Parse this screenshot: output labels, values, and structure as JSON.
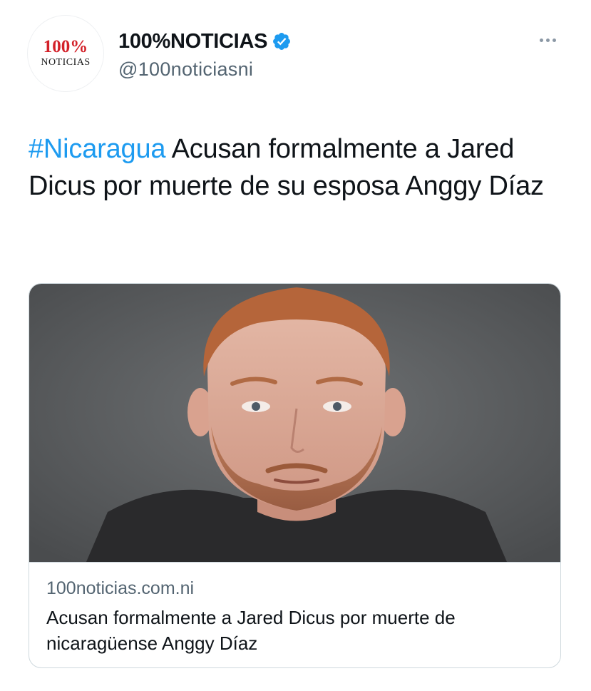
{
  "account": {
    "display_name": "100%NOTICIAS",
    "handle": "@100noticiasni",
    "avatar_logo_top": "100%",
    "avatar_logo_bottom": "NOTICIAS",
    "verified": true
  },
  "tweet": {
    "hashtag": "#Nicaragua",
    "text": " Acusan formalmente a Jared Dicus por muerte de su esposa Anggy Díaz"
  },
  "card": {
    "image_description": "mugshot",
    "domain": "100noticias.com.ni",
    "title": "Acusan formalmente a Jared Dicus por muerte de nicaragüense Anggy Díaz"
  },
  "colors": {
    "link": "#1d9bf0",
    "secondary_text": "#536471",
    "primary_text": "#0f1419",
    "brand_red": "#d32129",
    "border": "#cfd9de"
  },
  "icons": {
    "verified": "verified-badge-icon",
    "more": "more-options-icon"
  }
}
